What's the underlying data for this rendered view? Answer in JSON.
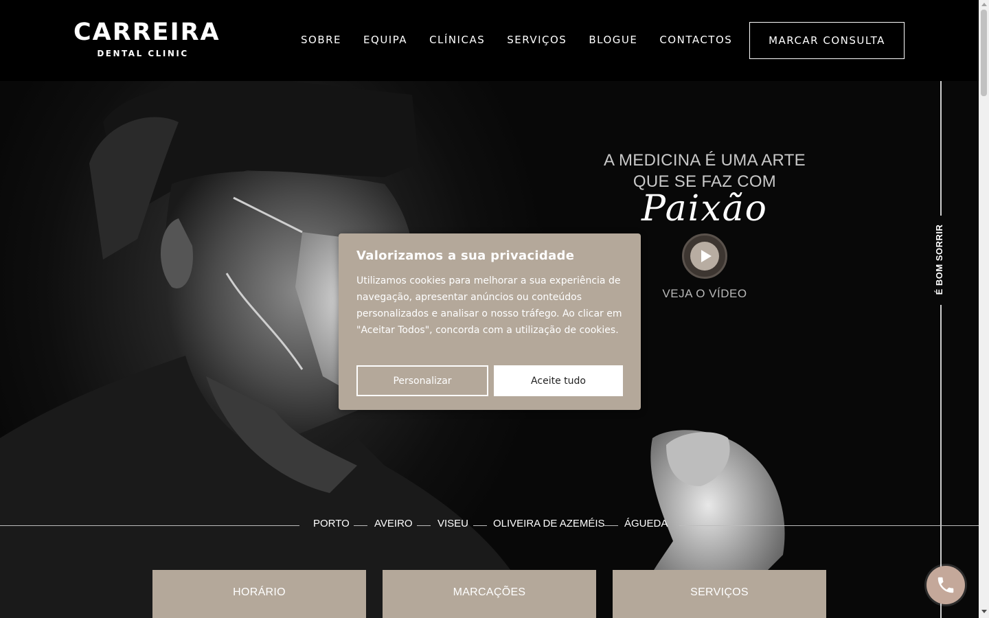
{
  "brand": {
    "name": "CARREIRA",
    "subtitle": "DENTAL CLINIC"
  },
  "nav": {
    "items": [
      {
        "label": "SOBRE"
      },
      {
        "label": "EQUIPA"
      },
      {
        "label": "CLÍNICAS"
      },
      {
        "label": "SERVIÇOS"
      },
      {
        "label": "BLOGUE"
      },
      {
        "label": "CONTACTOS"
      }
    ],
    "cta_label": "MARCAR CONSULTA"
  },
  "hero": {
    "tagline_line1": "A MEDICINA É UMA ARTE",
    "tagline_line2": "QUE SE FAZ COM",
    "tagline_script": "Paixão",
    "video_label": "VEJA O VÍDEO",
    "side_text": "É BOM SORRIR"
  },
  "cities": [
    "PORTO",
    "AVEIRO",
    "VISEU",
    "OLIVEIRA DE AZEMÉIS",
    "ÁGUEDA"
  ],
  "tiles": [
    {
      "label": "HORÁRIO"
    },
    {
      "label": "MARCAÇÕES"
    },
    {
      "label": "SERVIÇOS"
    }
  ],
  "cookie": {
    "title": "Valorizamos a sua privacidade",
    "text": "Utilizamos cookies para melhorar a sua experiência de navegação, apresentar anúncios ou conteúdos personalizados e analisar o nosso tráfego. Ao clicar em \"Aceitar Todos\", concorda com a utilização de cookies.",
    "customize_label": "Personalizar",
    "accept_label": "Aceite tudo"
  },
  "icons": {
    "play": "play-icon",
    "phone": "phone-icon"
  },
  "colors": {
    "accent": "#b4a89a",
    "phone": "#c4a89a",
    "header": "#000000"
  }
}
